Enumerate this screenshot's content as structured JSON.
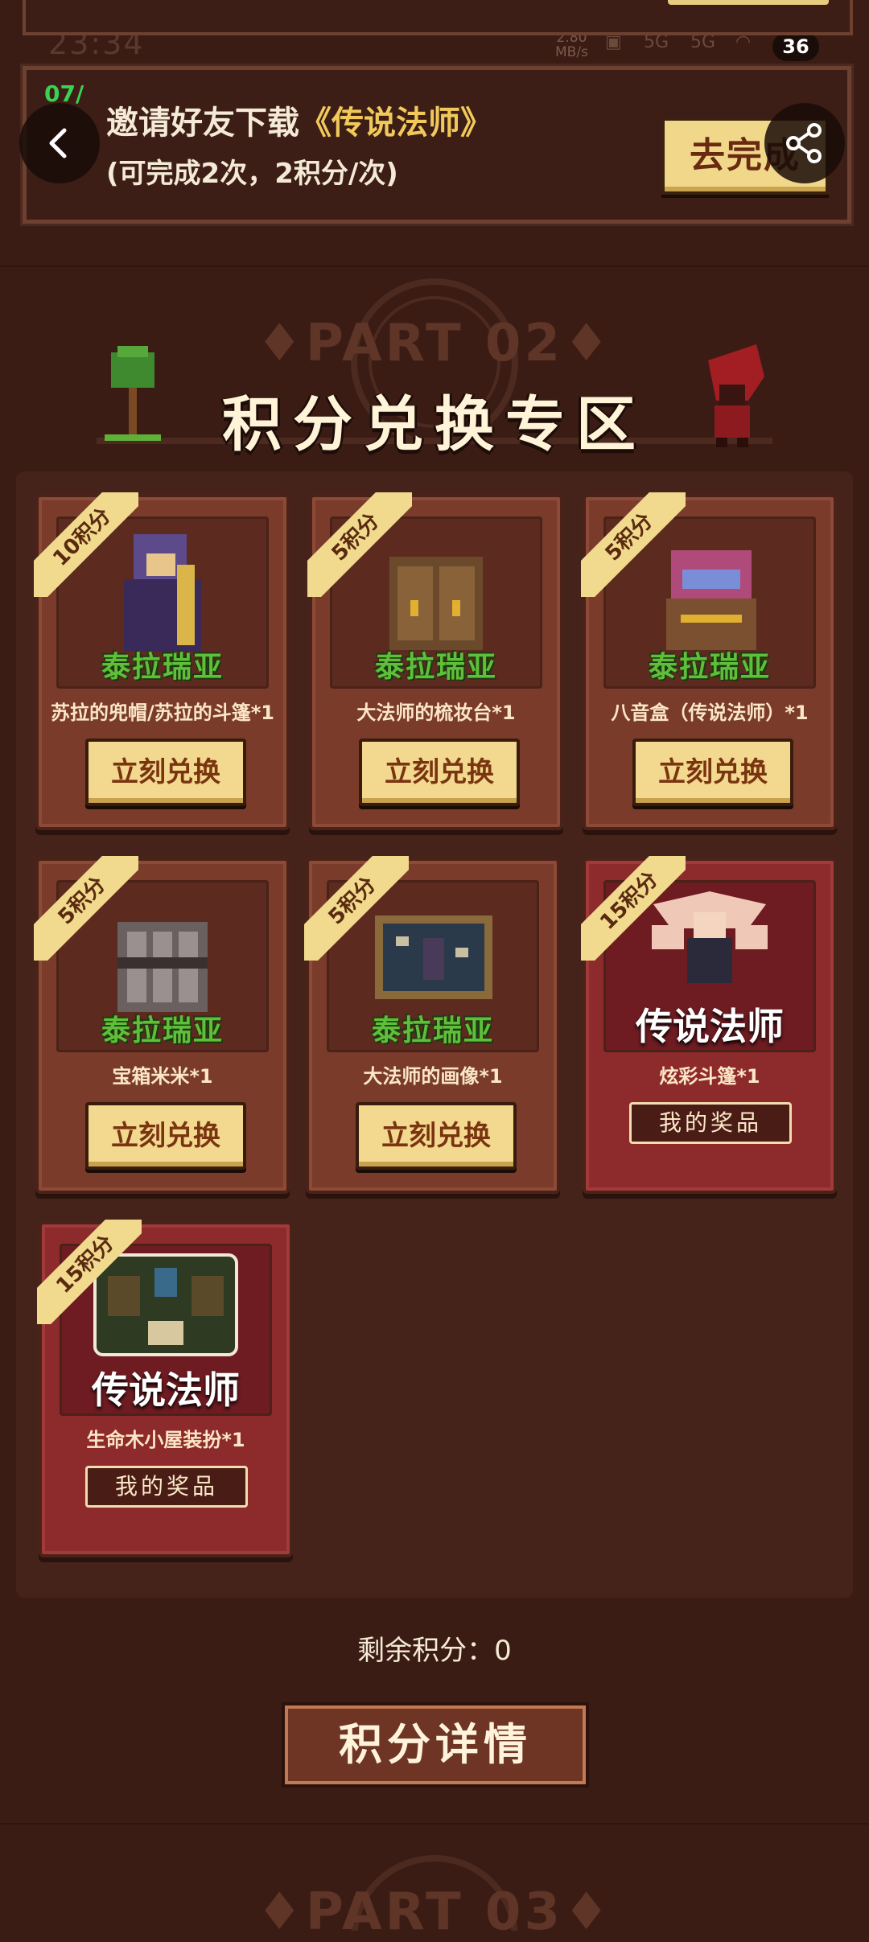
{
  "status_bar": {
    "time": "23:34",
    "net_speed": "2.80",
    "net_unit": "MB/s",
    "sig1": "5G",
    "sig2": "5G",
    "battery": "36"
  },
  "task": {
    "date": "07/",
    "title_prefix": "邀请好友下载",
    "title_game": "《传说法师》",
    "subtitle": "(可完成2次，2积分/次)",
    "button": "去完成"
  },
  "section": {
    "part": "♦PART 02♦",
    "title": "积分兑换专区"
  },
  "items": [
    {
      "ribbon": "10积分",
      "name": "苏拉的兜帽/苏拉的斗篷*1",
      "logo": "泰拉瑞亚",
      "button": "立刻兑换"
    },
    {
      "ribbon": "5积分",
      "name": "大法师的梳妆台*1",
      "logo": "泰拉瑞亚",
      "button": "立刻兑换"
    },
    {
      "ribbon": "5积分",
      "name": "八音盒（传说法师）*1",
      "logo": "泰拉瑞亚",
      "button": "立刻兑换"
    },
    {
      "ribbon": "5积分",
      "name": "宝箱米米*1",
      "logo": "泰拉瑞亚",
      "button": "立刻兑换"
    },
    {
      "ribbon": "5积分",
      "name": "大法师的画像*1",
      "logo": "泰拉瑞亚",
      "button": "立刻兑换"
    },
    {
      "ribbon": "15积分",
      "name": "炫彩斗篷*1",
      "logo": "传说法师",
      "button": "我的奖品"
    },
    {
      "ribbon": "15积分",
      "name": "生命木小屋装扮*1",
      "logo": "传说法师",
      "button": "我的奖品"
    }
  ],
  "remaining": "剩余积分：0",
  "details_button": "积分详情",
  "next_part": "♦PART 03♦",
  "icons": {
    "back": "back-arrow-icon",
    "share": "share-icon"
  }
}
